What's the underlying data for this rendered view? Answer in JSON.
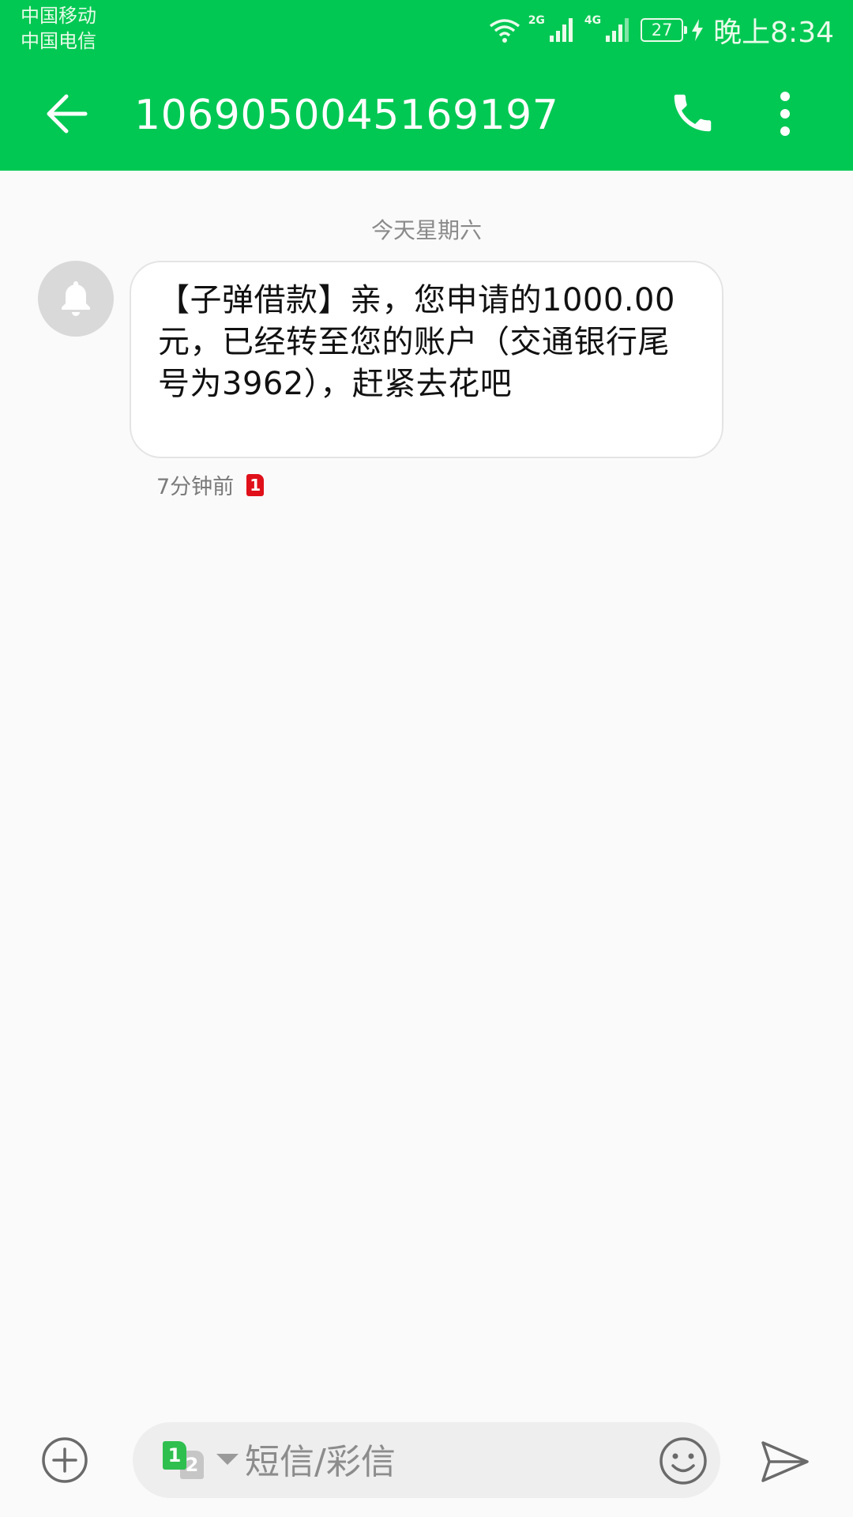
{
  "status_bar": {
    "carrier_1": "中国移动",
    "carrier_2": "中国电信",
    "net_1": "2G",
    "net_2": "4G",
    "battery": "27",
    "time": "晚上8:34"
  },
  "header": {
    "back_icon": "arrow-left-icon",
    "title": "1069050045169197",
    "call_icon": "phone-icon",
    "menu_icon": "more-vertical-icon"
  },
  "conversation": {
    "date_divider": "今天星期六",
    "avatar_icon": "bell-icon",
    "messages": [
      {
        "text": "【子弹借款】亲，您申请的1000.00元，已经转至您的账户（交通银行尾号为3962），赶紧去花吧",
        "time": "7分钟前",
        "sim": "1"
      }
    ]
  },
  "composer": {
    "add_icon": "plus-circle-icon",
    "sim_active": "1",
    "sim_inactive": "2",
    "placeholder": "短信/彩信",
    "emoji_icon": "smiley-icon",
    "send_icon": "send-icon"
  },
  "colors": {
    "header_bg": "#00c853",
    "sim1_badge": "#e0101a",
    "sim_active": "#2fbf4f"
  }
}
